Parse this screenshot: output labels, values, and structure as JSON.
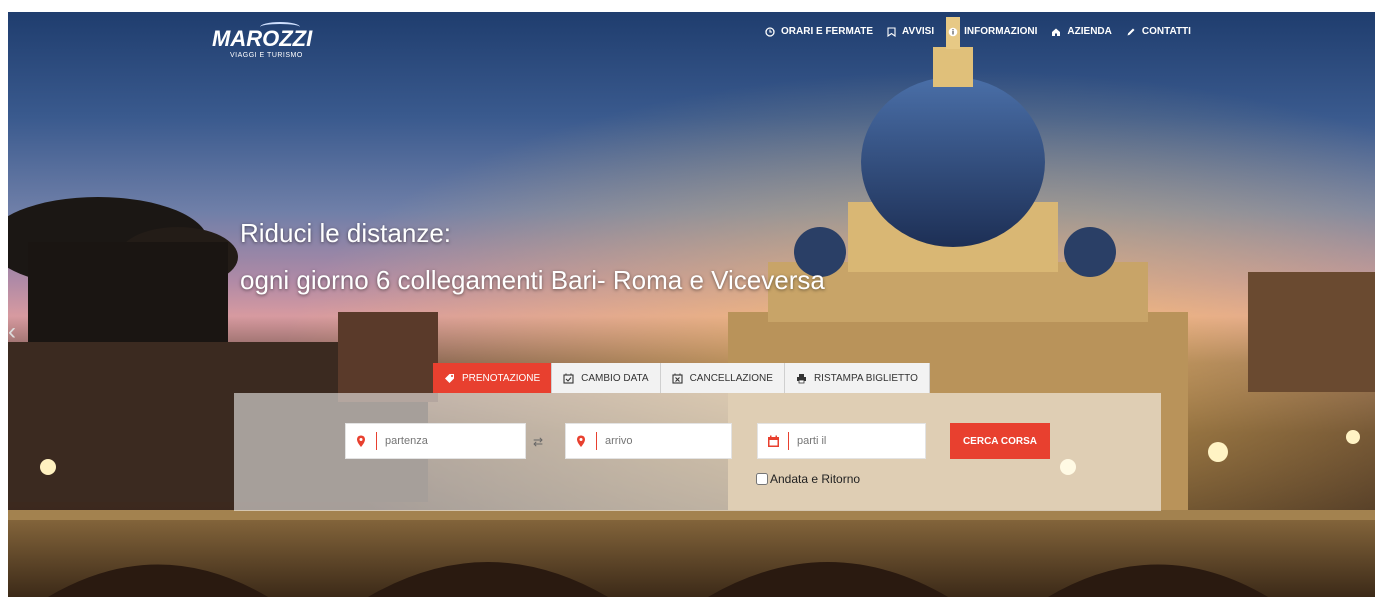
{
  "brand": {
    "name": "MAROZZI",
    "tagline": "VIAGGI E TURISMO"
  },
  "nav": [
    {
      "label": "ORARI E FERMATE",
      "icon": "clock-icon"
    },
    {
      "label": "AVVISI",
      "icon": "bookmark-icon"
    },
    {
      "label": "INFORMAZIONI",
      "icon": "info-icon"
    },
    {
      "label": "AZIENDA",
      "icon": "home-icon"
    },
    {
      "label": "CONTATTI",
      "icon": "pencil-icon"
    }
  ],
  "hero": {
    "line1": "Riduci le distanze:",
    "line2": "ogni giorno 6 collegamenti Bari- Roma e Viceversa"
  },
  "tabs": [
    {
      "label": "PRENOTAZIONE",
      "icon": "tag-icon",
      "active": true
    },
    {
      "label": "CAMBIO DATA",
      "icon": "calendar-check-icon",
      "active": false
    },
    {
      "label": "CANCELLAZIONE",
      "icon": "calendar-x-icon",
      "active": false
    },
    {
      "label": "RISTAMPA BIGLIETTO",
      "icon": "printer-icon",
      "active": false
    }
  ],
  "search": {
    "from_placeholder": "partenza",
    "to_placeholder": "arrivo",
    "date_placeholder": "parti il",
    "button": "CERCA CORSA",
    "roundtrip_label": "Andata e Ritorno"
  },
  "colors": {
    "accent": "#e8402f",
    "panel": "rgba(255,255,255,0.55)"
  }
}
